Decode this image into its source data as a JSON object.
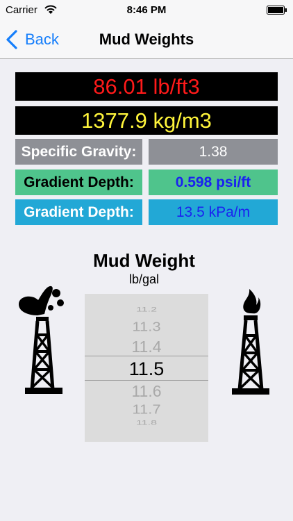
{
  "status": {
    "carrier": "Carrier",
    "time": "8:46 PM"
  },
  "nav": {
    "back_label": "Back",
    "title": "Mud Weights"
  },
  "results": {
    "lb_ft3": "86.01 lb/ft3",
    "kg_m3": "1377.9 kg/m3",
    "specific_gravity_label": "Specific Gravity:",
    "specific_gravity_value": "1.38",
    "gradient_psi_label": "Gradient Depth:",
    "gradient_psi_value": "0.598 psi/ft",
    "gradient_kpa_label": "Gradient Depth:",
    "gradient_kpa_value": "13.5 kPa/m"
  },
  "picker": {
    "title": "Mud Weight",
    "unit": "lb/gal",
    "options": [
      "11.2",
      "11.3",
      "11.4",
      "11.5",
      "11.6",
      "11.7",
      "11.8"
    ],
    "selected": "11.5"
  },
  "icons": {
    "left": "oil-gusher-rig-icon",
    "right": "gas-flare-rig-icon"
  },
  "colors": {
    "accent": "#157efb",
    "lb_text": "#ff1a1a",
    "kg_text": "#fff53b",
    "sg_bg": "#8e9096",
    "psi_bg": "#4fc48c",
    "kpa_bg": "#22a8d6",
    "value_text": "#1a22f0"
  }
}
